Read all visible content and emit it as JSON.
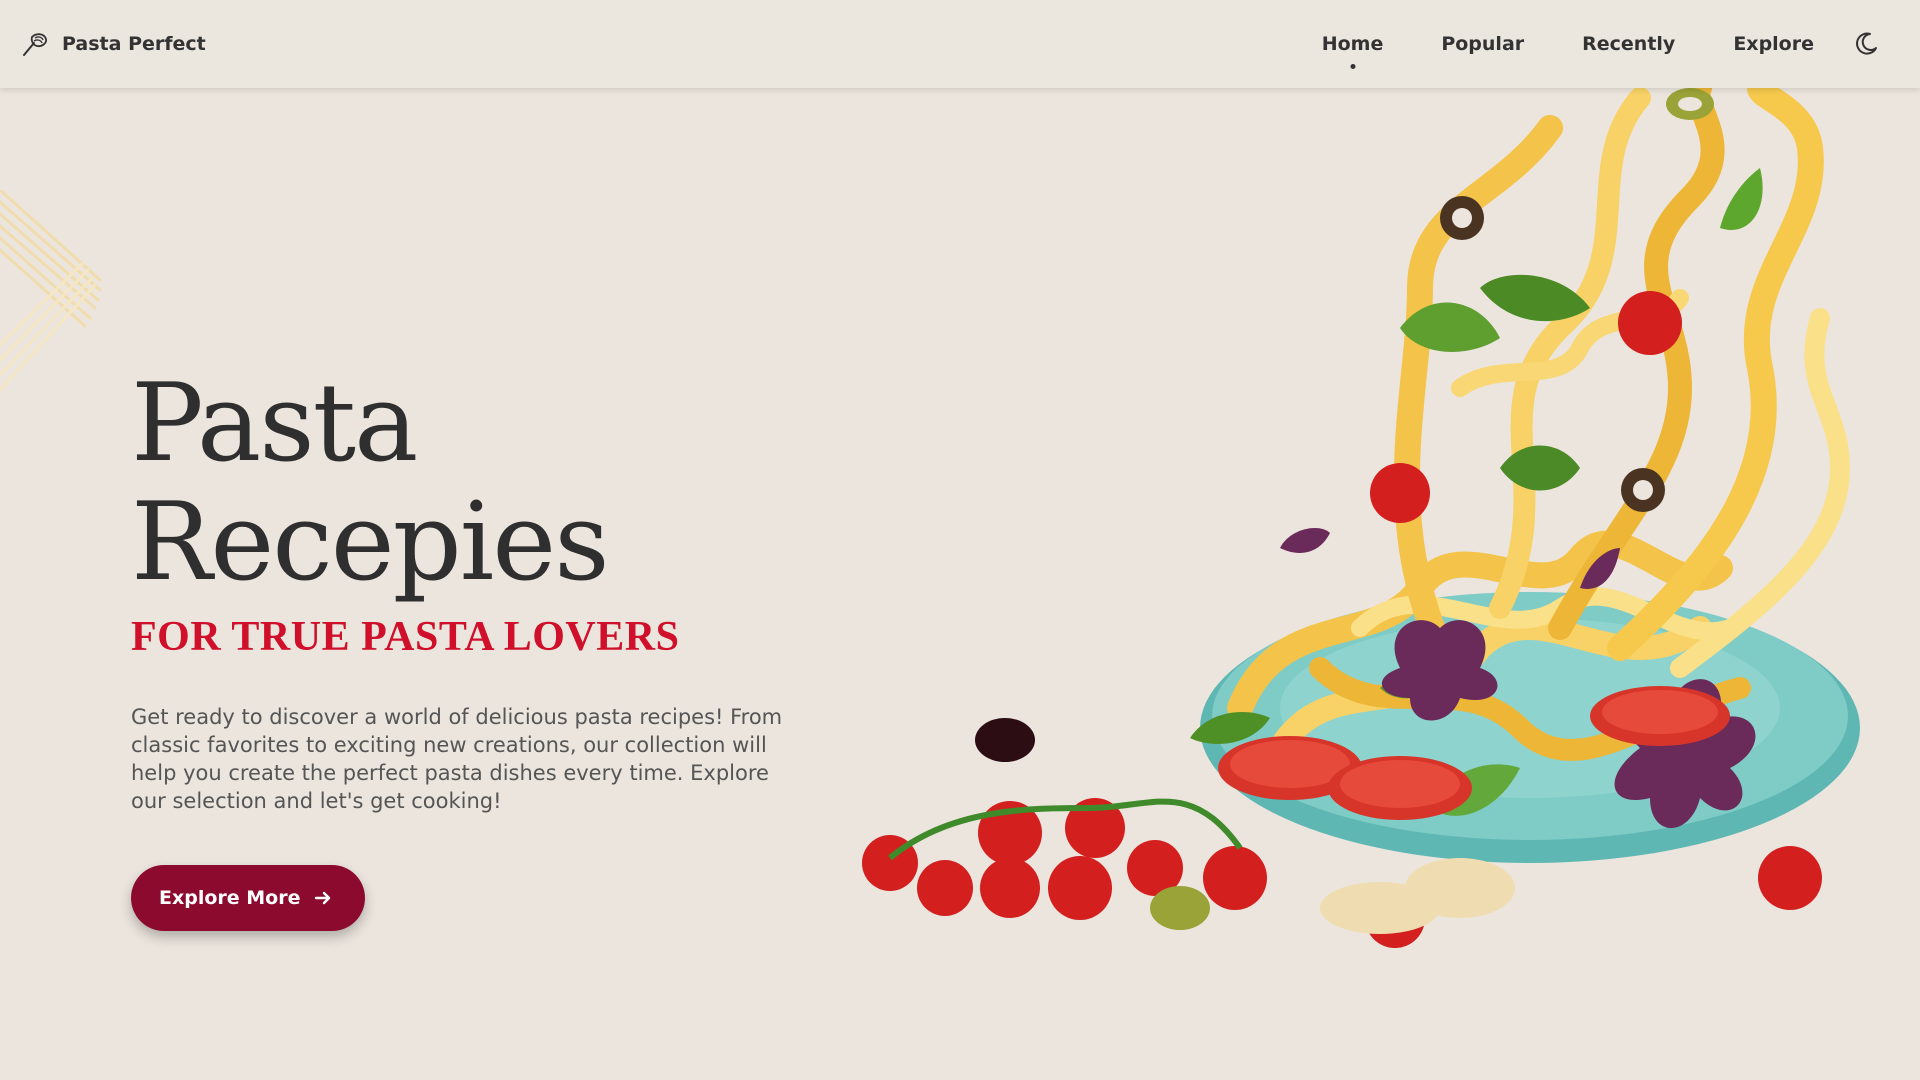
{
  "header": {
    "brand": "Pasta Perfect",
    "nav": [
      {
        "label": "Home",
        "active": true
      },
      {
        "label": "Popular",
        "active": false
      },
      {
        "label": "Recently",
        "active": false
      },
      {
        "label": "Explore",
        "active": false
      }
    ],
    "icons": {
      "logo": "pasta-fork-icon",
      "theme_toggle": "moon-icon"
    }
  },
  "hero": {
    "title": "Pasta Recepies",
    "subtitle": "FOR TRUE PASTA LOVERS",
    "description": "Get ready to discover a world of delicious pasta recipes! From classic favorites to exciting new creations, our collection will help you create the perfect pasta dishes every time. Explore our selection and let's get cooking!",
    "cta_label": "Explore More",
    "cta_icon": "arrow-right-icon"
  },
  "colors": {
    "background": "#ebe5dd",
    "accent_red": "#d0102a",
    "button": "#8c0a2e",
    "text_dark": "#2f2f2f"
  }
}
